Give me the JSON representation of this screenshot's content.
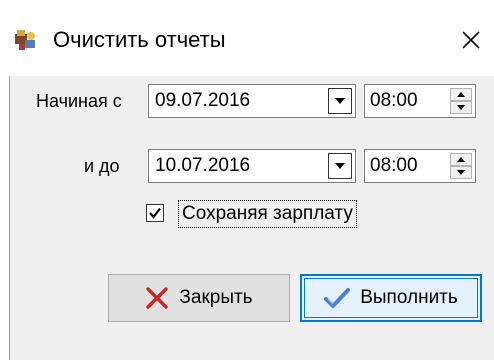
{
  "window": {
    "title": "Очистить отчеты"
  },
  "form": {
    "start_label": "Начиная с",
    "start_date": "09.07.2016",
    "start_time": "08:00",
    "end_label": "и до",
    "end_date": "10.07.2016",
    "end_time": "08:00",
    "keep_salary_label": "Сохраняя зарплату",
    "keep_salary_checked": true
  },
  "buttons": {
    "close_label": "Закрыть",
    "execute_label": "Выполнить"
  },
  "colors": {
    "close_icon": "#c62828",
    "execute_icon": "#4a7fd4",
    "accent": "#0078d7"
  }
}
